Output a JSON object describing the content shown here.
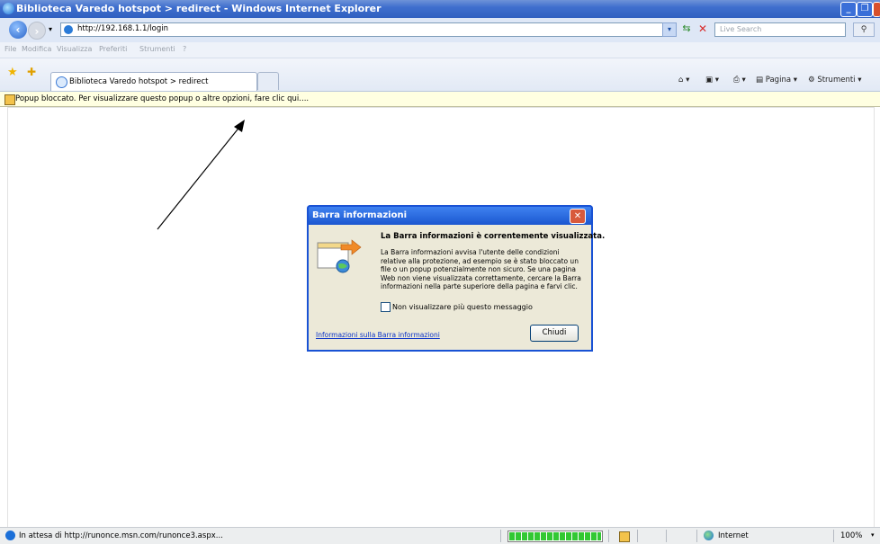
{
  "window": {
    "title": "Biblioteca Varedo hotspot > redirect - Windows Internet Explorer"
  },
  "address_bar": {
    "url": "http://192.168.1.1/login",
    "search_placeholder": "Live Search"
  },
  "menu": {
    "items": [
      "File",
      "Modifica",
      "Visualizza",
      "Preferiti",
      "Strumenti",
      "?"
    ]
  },
  "tabs": [
    {
      "label": "Biblioteca Varedo hotspot > redirect"
    }
  ],
  "command_bar": {
    "page_label": "Pagina",
    "tools_label": "Strumenti"
  },
  "info_bar": {
    "text": "Popup bloccato. Per visualizzare questo popup o altre opzioni, fare clic qui...."
  },
  "dialog": {
    "title": "Barra informazioni",
    "heading": "La Barra informazioni è correntemente visualizzata.",
    "description": "La Barra informazioni avvisa l'utente delle condizioni relative alla protezione, ad esempio se è stato bloccato un file o un popup potenzialmente non sicuro. Se una pagina Web non viene visualizzata correttamente, cercare la Barra informazioni nella parte superiore della pagina e farvi clic.",
    "checkbox_label": "Non visualizzare più questo messaggio",
    "checkbox_checked": false,
    "link": "Informazioni sulla Barra informazioni",
    "close_button": "Chiudi"
  },
  "status_bar": {
    "text": "In attesa di http://runonce.msn.com/runonce3.aspx...",
    "progress": 1.0,
    "zone": "Internet",
    "zoom": "100%"
  }
}
